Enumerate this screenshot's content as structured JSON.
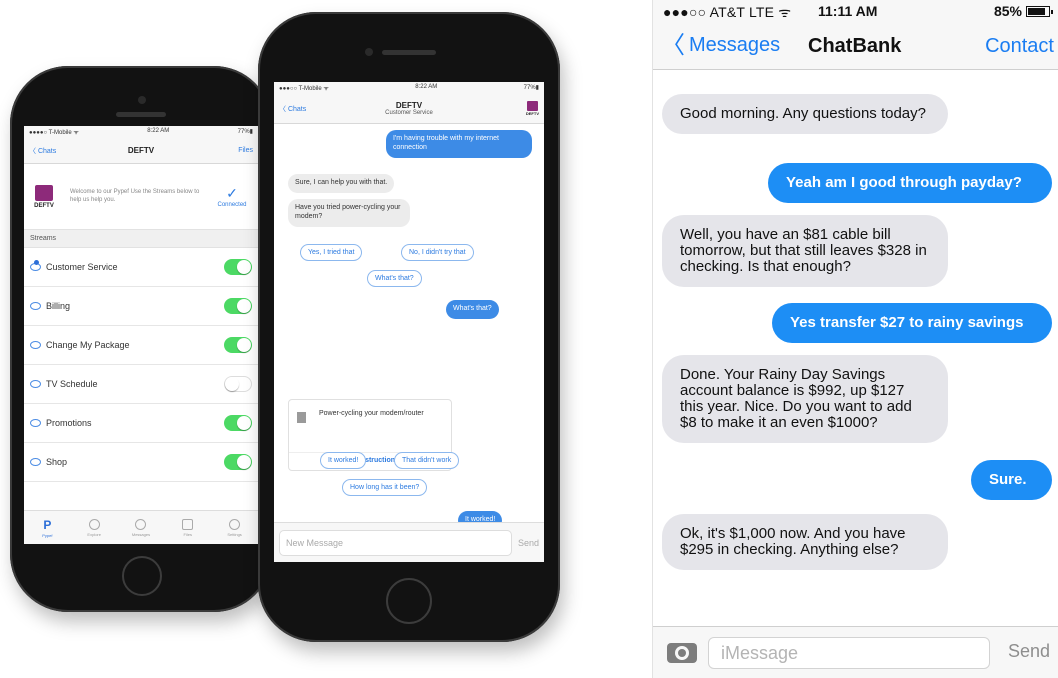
{
  "phone1": {
    "status": {
      "carrier": "●●●●○ T-Mobile ᯤ",
      "time": "8:22 AM",
      "battery": "77%▮"
    },
    "nav": {
      "back": "〈 Chats",
      "title": "DEFTV",
      "right": "Files"
    },
    "welcome": {
      "logo_text": "DEFTV",
      "text": "Welcome to our Pypef Use the Streams below to help us help you.",
      "status": "Connected"
    },
    "section_title": "Streams",
    "streams": [
      {
        "label": "Customer Service",
        "on": true
      },
      {
        "label": "Billing",
        "on": true
      },
      {
        "label": "Change My Package",
        "on": true
      },
      {
        "label": "TV Schedule",
        "on": false
      },
      {
        "label": "Promotions",
        "on": true
      },
      {
        "label": "Shop",
        "on": true
      }
    ],
    "tabs": [
      "Pypef",
      "Explore",
      "Messages",
      "Files",
      "Settings"
    ]
  },
  "phone2": {
    "status": {
      "carrier": "●●●○○ T-Mobile ᯤ",
      "time": "8:22 AM",
      "battery": "77%▮"
    },
    "nav": {
      "back": "〈 Chats",
      "title": "DEFTV",
      "subtitle": "Customer Service",
      "logo_text": "DEFTV"
    },
    "messages": {
      "m1": "I'm having trouble with my internet connection",
      "m2": "Sure, I can help you with that.",
      "m3": "Have you tried power-cycling your modem?",
      "m4": "What's that?",
      "m5": "It worked!"
    },
    "quick_replies_1": [
      "Yes, I tried that",
      "No, I didn't try that",
      "What's that?"
    ],
    "card": {
      "title": "Power-cycling your modem/router",
      "link": "View instructions"
    },
    "quick_replies_2": [
      "It worked!",
      "That didn't work",
      "How long has it been?"
    ],
    "composer": {
      "placeholder": "New Message",
      "send": "Send"
    }
  },
  "imessage": {
    "status": {
      "carrier": "●●●○○ AT&T LTE ᯤ",
      "time": "11:11 AM",
      "battery": "85%"
    },
    "nav": {
      "back": "Messages",
      "title": "ChatBank",
      "right": "Contact"
    },
    "messages": [
      {
        "from": "in",
        "text": "Good morning. Any questions today?"
      },
      {
        "from": "out",
        "text": "Yeah am I good through payday?"
      },
      {
        "from": "in",
        "text": "Well, you have an $81 cable bill tomorrow, but that still leaves $328 in checking. Is that enough?"
      },
      {
        "from": "out",
        "text": "Yes transfer $27 to rainy savings"
      },
      {
        "from": "in",
        "text": "Done. Your Rainy Day Savings account balance is $992, up $127 this year. Nice. Do you want to add $8 to make it an even $1000?"
      },
      {
        "from": "out",
        "text": "Sure."
      },
      {
        "from": "in",
        "text": "Ok, it's $1,000 now. And you have $295 in checking. Anything else?"
      }
    ],
    "composer": {
      "placeholder": "iMessage",
      "send": "Send"
    }
  },
  "colors": {
    "imessage_blue": "#1d8ef5",
    "toggle_green": "#4cd964",
    "link_blue": "#2d7be0"
  }
}
